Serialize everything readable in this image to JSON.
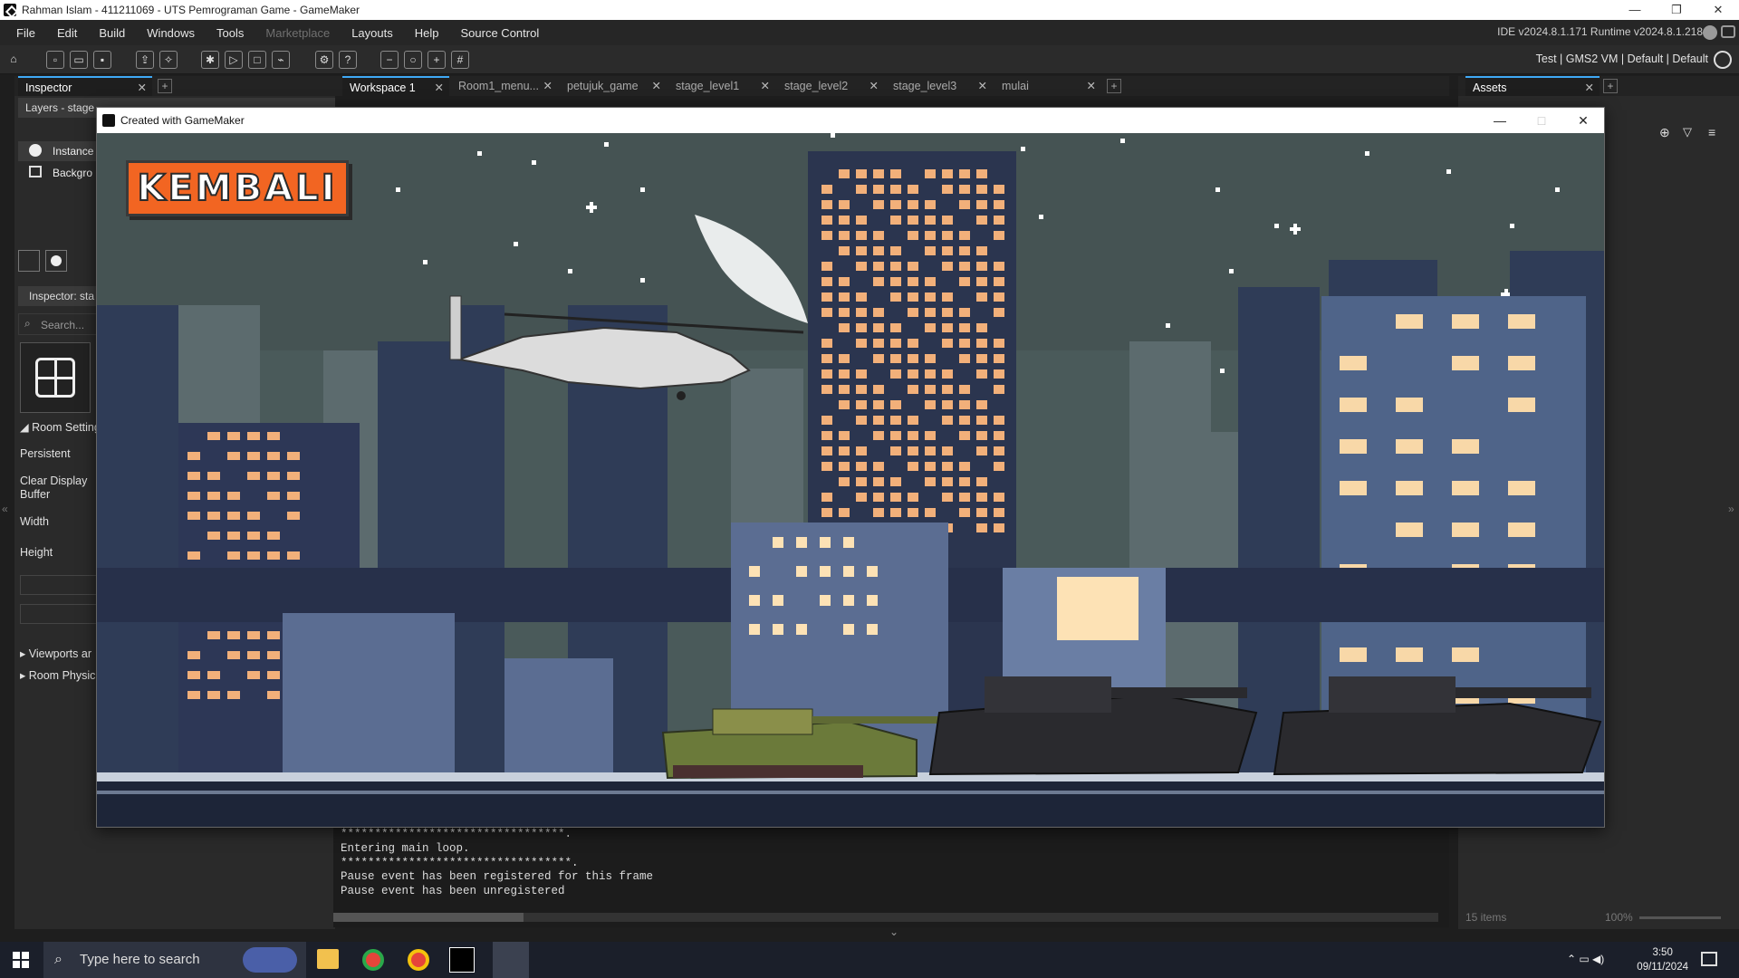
{
  "window": {
    "title": "Rahman Islam - 411211069 - UTS Pemrograman Game - GameMaker",
    "controls": [
      "—",
      "❐",
      "✕"
    ]
  },
  "menu": {
    "items": [
      {
        "label": "File",
        "enabled": true
      },
      {
        "label": "Edit",
        "enabled": true
      },
      {
        "label": "Build",
        "enabled": true
      },
      {
        "label": "Windows",
        "enabled": true
      },
      {
        "label": "Tools",
        "enabled": true
      },
      {
        "label": "Marketplace",
        "enabled": false
      },
      {
        "label": "Layouts",
        "enabled": true
      },
      {
        "label": "Help",
        "enabled": true
      },
      {
        "label": "Source Control",
        "enabled": true
      }
    ],
    "version": "IDE v2024.8.1.171  Runtime v2024.8.1.218"
  },
  "toolbar": {
    "target": "Test | GMS2 VM | Default | Default"
  },
  "left_panel": {
    "tab": "Inspector",
    "layers_label": "Layers - stage",
    "layers": [
      {
        "label": "Instance",
        "icon": "instance-layer-icon"
      },
      {
        "label": "Backgro",
        "icon": "background-layer-icon"
      }
    ],
    "inspector_label": "Inspector: sta",
    "search_placeholder": "Search...",
    "section_room_settings": "Room Setting",
    "persistent": "Persistent",
    "clear_display_1": "Clear Display",
    "clear_display_2": "Buffer",
    "width": "Width",
    "height": "Height",
    "viewports": "Viewports ar",
    "physics": "Room Physic"
  },
  "workspace_tabs": [
    {
      "label": "Workspace 1",
      "active": true
    },
    {
      "label": "Room1_menu...",
      "active": false
    },
    {
      "label": "petujuk_game",
      "active": false
    },
    {
      "label": "stage_level1",
      "active": false
    },
    {
      "label": "stage_level2",
      "active": false
    },
    {
      "label": "stage_level3",
      "active": false
    },
    {
      "label": "mulai",
      "active": false
    }
  ],
  "assets_panel": {
    "tab": "Assets",
    "count": "15 items",
    "zoom": "100%"
  },
  "game_window": {
    "title": "Created with GameMaker",
    "back_button": "KEMBALI"
  },
  "console": {
    "lines": [
      "*********************************.",
      "Entering main loop.",
      "**********************************.",
      "Pause event has been registered for this frame",
      "Pause event has been unregistered"
    ]
  },
  "taskbar": {
    "search_placeholder": "Type here to search",
    "time": "3:50",
    "date": "09/11/2024"
  },
  "colors": {
    "accent": "#3fa9f5",
    "button_orange": "#f26522",
    "sky": "#4a5a5a",
    "window_lit": "#f2b07a"
  }
}
